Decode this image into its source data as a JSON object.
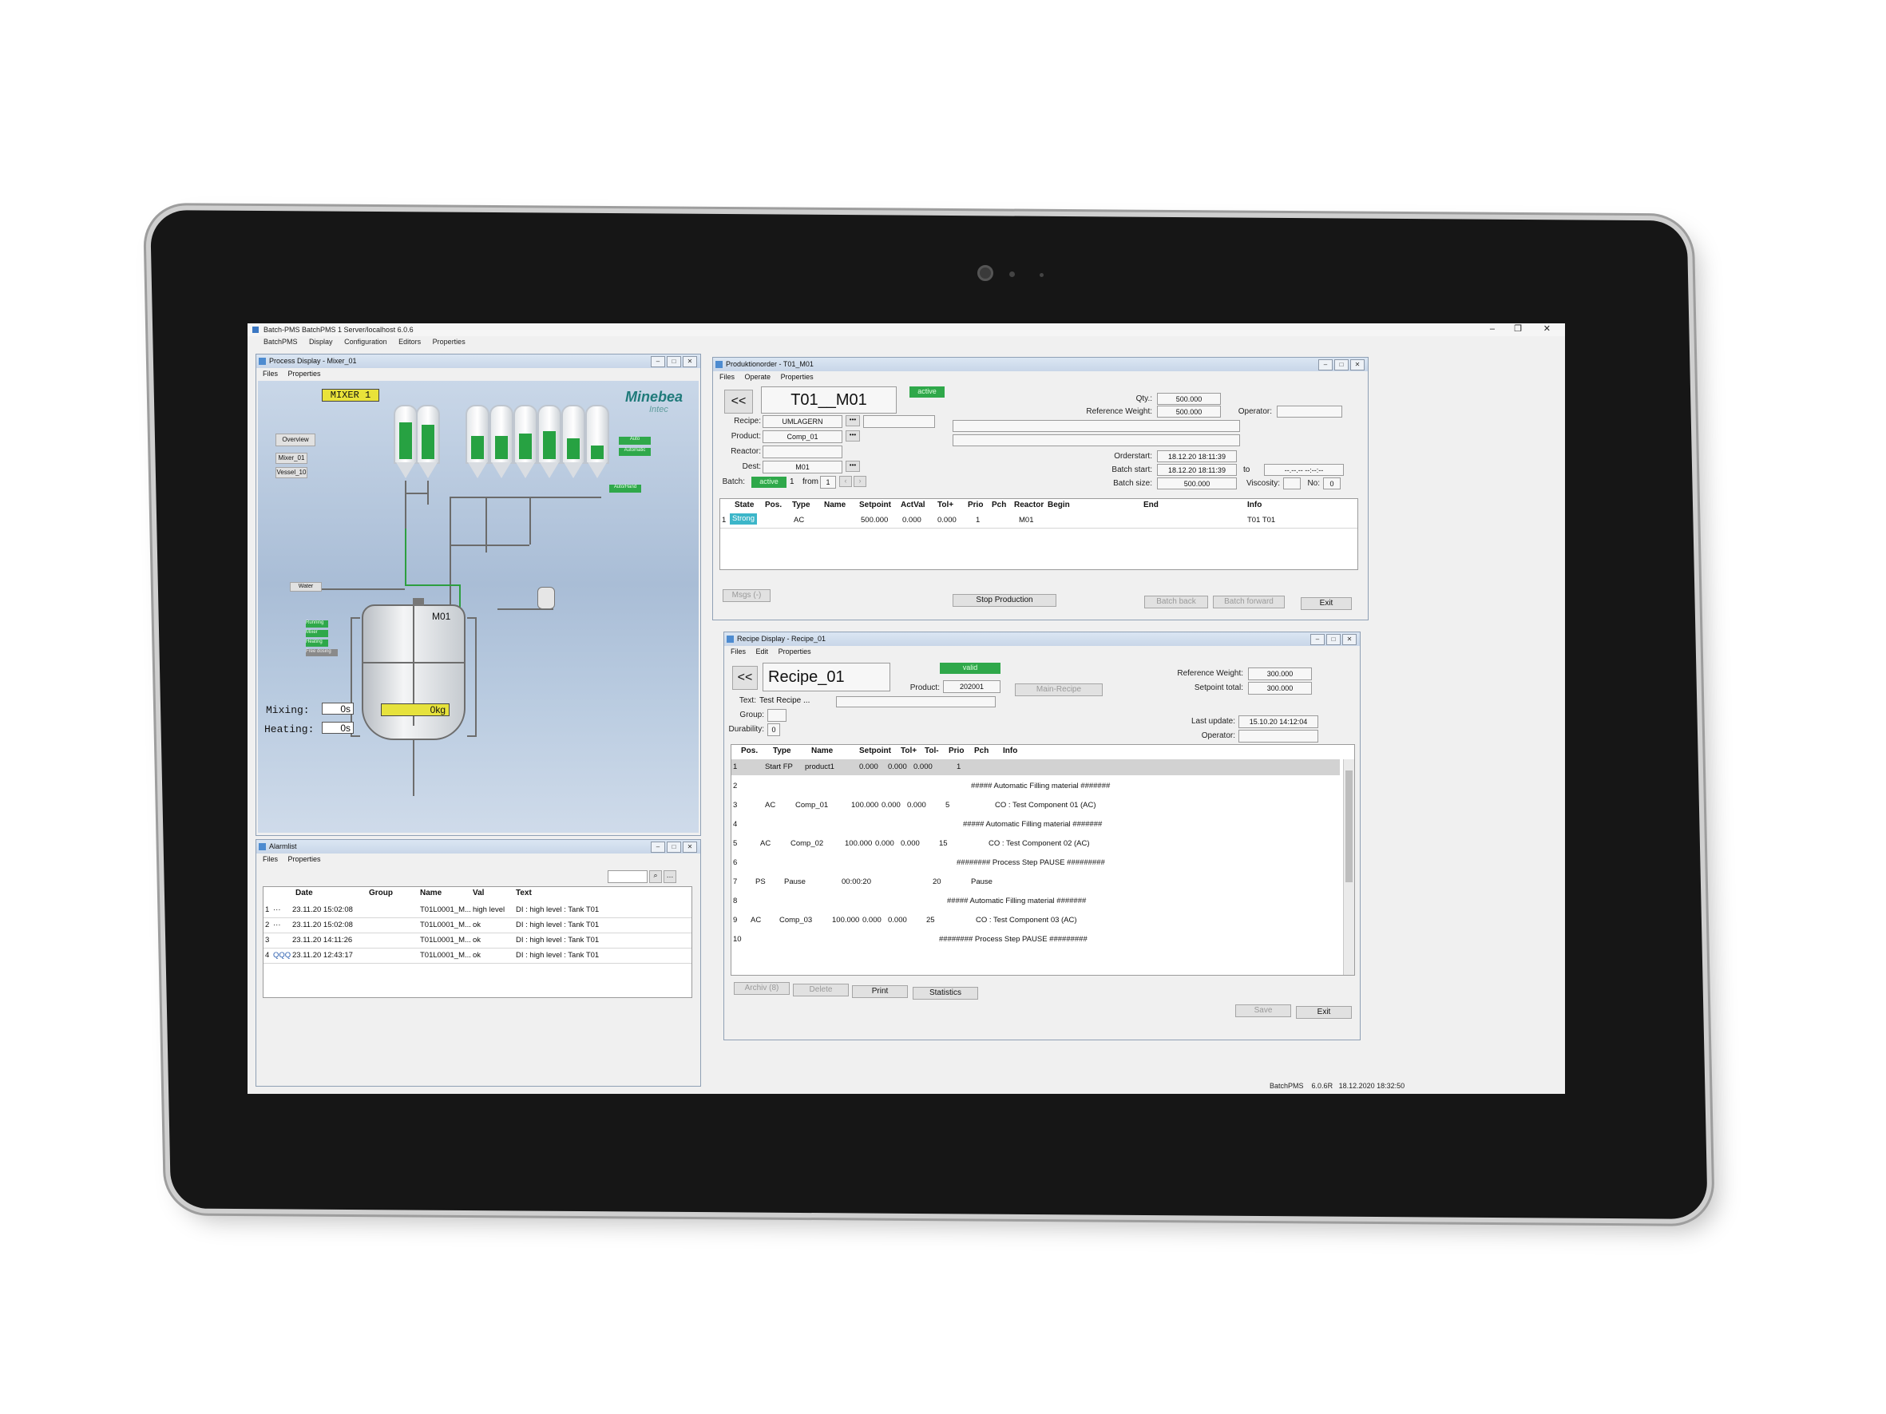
{
  "app": {
    "title": "Batch-PMS BatchPMS 1 Server/localhost 6.0.6",
    "menu": [
      "BatchPMS",
      "Display",
      "Configuration",
      "Editors",
      "Properties"
    ],
    "status_app": "BatchPMS",
    "status_version": "6.0.6R",
    "status_datetime": "18.12.2020 18:32:50"
  },
  "process": {
    "title": "Process Display - Mixer_01",
    "menu": [
      "Files",
      "Properties"
    ],
    "mixer_label": "MIXER 1",
    "brand": "Minebea",
    "brand_sub": "Intec",
    "nav_buttons": [
      "Overview",
      "Mixer_01",
      "Vessel_10"
    ],
    "water_label": "Water",
    "tank_label": "M01",
    "mixing_label": "Mixing:",
    "mixing_value": "0s",
    "heating_label": "Heating:",
    "heating_value": "0s",
    "weight_value": "0kg",
    "auto_labels": [
      "Auto",
      "Automatic",
      "Auto/Hand"
    ],
    "status_labels": [
      "Running",
      "Mixer",
      "Heating",
      "Free dosing"
    ],
    "silo_levels": [
      0.8,
      0.75,
      0.5,
      0.5,
      0.55,
      0.6,
      0.45,
      0.3
    ]
  },
  "alarm": {
    "title": "Alarmlist",
    "menu": [
      "Files",
      "Properties"
    ],
    "headers": [
      "Date",
      "Group",
      "Name",
      "Val",
      "Text"
    ],
    "rows": [
      {
        "n": "1",
        "mark": "···",
        "date": "23.11.20 15:02:08",
        "group": "",
        "name": "T01L0001_M...",
        "val": "high level",
        "text": "DI : high level : Tank T01"
      },
      {
        "n": "2",
        "mark": "···",
        "date": "23.11.20 15:02:08",
        "group": "",
        "name": "T01L0001_M...",
        "val": "ok",
        "text": "DI : high level : Tank T01"
      },
      {
        "n": "3",
        "mark": "",
        "date": "23.11.20 14:11:26",
        "group": "",
        "name": "T01L0001_M...",
        "val": "ok",
        "text": "DI : high level : Tank T01"
      },
      {
        "n": "4",
        "mark": "QQQ",
        "date": "23.11.20 12:43:17",
        "group": "",
        "name": "T01L0001_M...",
        "val": "ok",
        "text": "DI : high level : Tank T01"
      }
    ]
  },
  "order": {
    "title": "Produktionorder - T01_M01",
    "menu": [
      "Files",
      "Operate",
      "Properties"
    ],
    "back": "<<",
    "name": "T01__M01",
    "state": "active",
    "recipe_label": "Recipe:",
    "recipe": "UMLAGERN",
    "product_label": "Product:",
    "product": "Comp_01",
    "reactor_label": "Reactor:",
    "dest_label": "Dest:",
    "dest": "M01",
    "batch_label": "Batch:",
    "batch_state": "active",
    "batch_no": "1",
    "from_label": "from",
    "batch_of": "1",
    "qty_label": "Qty.:",
    "qty": "500.000",
    "refweight_label": "Reference Weight:",
    "refweight": "500.000",
    "operator_label": "Operator:",
    "orderstart_label": "Orderstart:",
    "orderstart": "18.12.20 18:11:39",
    "batchstart_label": "Batch start:",
    "batchstart": "18.12.20 18:11:39",
    "to_label": "to",
    "to_value": "--.--.-- --:--:--",
    "batchsize_label": "Batch size:",
    "batchsize": "500.000",
    "viscosity_label": "Viscosity:",
    "no_label": "No:",
    "no_value": "0",
    "dots": "•••",
    "headers": [
      "State",
      "Pos.",
      "Type",
      "Name",
      "Setpoint",
      "ActVal",
      "Tol+",
      "Prio",
      "Pch",
      "Reactor",
      "Begin",
      "End",
      "Info"
    ],
    "row": {
      "n": "1",
      "state": "Strong",
      "pos": "",
      "type": "AC",
      "name": "",
      "setpoint": "500.000",
      "actval": "0.000",
      "tol": "0.000",
      "prio": "1",
      "pch": "",
      "reactor": "M01",
      "begin": "",
      "end": "",
      "info": "T01 T01"
    },
    "buttons": {
      "msgs": "Msgs (-)",
      "stop": "Stop Production",
      "back": "Batch back",
      "forward": "Batch forward",
      "exit": "Exit"
    }
  },
  "recipe": {
    "title": "Recipe Display - Recipe_01",
    "menu": [
      "Files",
      "Edit",
      "Properties"
    ],
    "back": "<<",
    "name": "Recipe_01",
    "state": "valid",
    "product_label": "Product:",
    "product": "202001",
    "main_recipe": "Main-Recipe",
    "text_label": "Text:",
    "text": "Test Recipe ...",
    "group_label": "Group:",
    "durability_label": "Durability:",
    "durability": "0",
    "refweight_label": "Reference Weight:",
    "refweight": "300.000",
    "setpointtotal_label": "Setpoint total:",
    "setpointtotal": "300.000",
    "lastupdate_label": "Last update:",
    "lastupdate": "15.10.20 14:12:04",
    "operator_label": "Operator:",
    "headers": [
      "Pos.",
      "Type",
      "Name",
      "Setpoint",
      "Tol+",
      "Tol-",
      "Prio",
      "Pch",
      "Info"
    ],
    "rows": [
      {
        "n": "1",
        "type": "Start FP",
        "name": "product1",
        "sp": "0.000",
        "tp": "0.000",
        "tm": "0.000",
        "prio": "1",
        "info": ""
      },
      {
        "n": "2",
        "type": "",
        "name": "",
        "sp": "",
        "tp": "",
        "tm": "",
        "prio": "",
        "info": "##### Automatic Filling material #######"
      },
      {
        "n": "3",
        "type": "AC",
        "name": "Comp_01",
        "sp": "100.000",
        "tp": "0.000",
        "tm": "0.000",
        "prio": "5",
        "info": "CO : Test Component 01 (AC)"
      },
      {
        "n": "4",
        "type": "",
        "name": "",
        "sp": "",
        "tp": "",
        "tm": "",
        "prio": "",
        "info": "##### Automatic Filling material #######"
      },
      {
        "n": "5",
        "type": "AC",
        "name": "Comp_02",
        "sp": "100.000",
        "tp": "0.000",
        "tm": "0.000",
        "prio": "15",
        "info": "CO : Test Component 02 (AC)"
      },
      {
        "n": "6",
        "type": "",
        "name": "",
        "sp": "",
        "tp": "",
        "tm": "",
        "prio": "",
        "info": "######## Process Step PAUSE #########"
      },
      {
        "n": "7",
        "type": "PS",
        "name": "Pause",
        "sp": "00:00:20",
        "tp": "",
        "tm": "",
        "prio": "20",
        "info": "Pause"
      },
      {
        "n": "8",
        "type": "",
        "name": "",
        "sp": "",
        "tp": "",
        "tm": "",
        "prio": "",
        "info": "##### Automatic Filling material #######"
      },
      {
        "n": "9",
        "type": "AC",
        "name": "Comp_03",
        "sp": "100.000",
        "tp": "0.000",
        "tm": "0.000",
        "prio": "25",
        "info": "CO : Test Component 03 (AC)"
      },
      {
        "n": "10",
        "type": "",
        "name": "",
        "sp": "",
        "tp": "",
        "tm": "",
        "prio": "",
        "info": "######## Process Step PAUSE #########"
      }
    ],
    "buttons": {
      "archiv": "Archiv (8)",
      "delete": "Delete",
      "print": "Print",
      "statistics": "Statistics",
      "save": "Save",
      "exit": "Exit"
    }
  }
}
